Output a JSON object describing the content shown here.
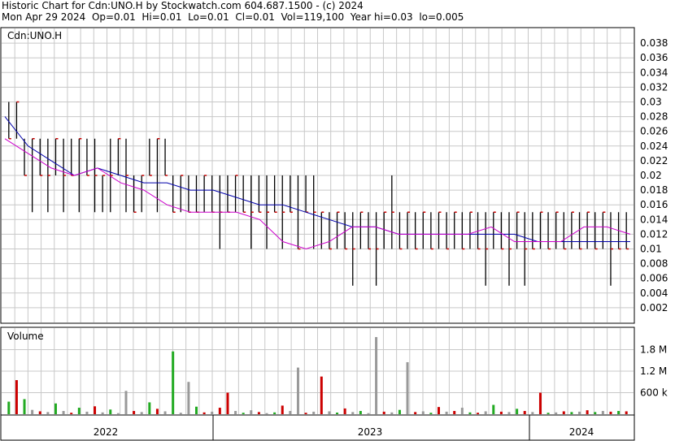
{
  "header": {
    "line1": "Historic Chart for Cdn:UNO.H by Stockwatch.com 604.687.1500 - (c) 2024",
    "line2": "Mon Apr 29 2024  Op=0.01  Hi=0.01  Lo=0.01  Cl=0.01  Vol=119,100  Year hi=0.03  lo=0.005"
  },
  "colors": {
    "grid": "#c8c8c8",
    "price_bar": "#000000",
    "close_mark": "#cc0000",
    "ma_short": "#cc00cc",
    "ma_long": "#0000aa",
    "vol_up": "#22aa22",
    "vol_down": "#cc0000",
    "vol_flat": "#999999"
  },
  "chart_data": [
    {
      "type": "line",
      "title": "Cdn:UNO.H",
      "ylim": [
        0,
        0.04
      ],
      "y_ticks": [
        "0.038",
        "0.036",
        "0.034",
        "0.032",
        "0.03",
        "0.028",
        "0.026",
        "0.024",
        "0.022",
        "0.02",
        "0.018",
        "0.016",
        "0.014",
        "0.012",
        "0.01",
        "0.008",
        "0.006",
        "0.004",
        "0.002"
      ],
      "x_labels": [
        "2022",
        "2023",
        "2024"
      ],
      "series": [
        {
          "x": [
            "2022-01",
            "2022-02",
            "2022-03",
            "2022-04",
            "2022-05",
            "2022-06",
            "2022-07",
            "2022-08",
            "2022-09",
            "2022-10",
            "2022-11",
            "2022-12",
            "2023-01",
            "2023-02",
            "2023-03",
            "2023-04",
            "2023-05",
            "2023-06",
            "2023-07",
            "2023-08",
            "2023-09",
            "2023-10",
            "2023-11",
            "2023-12",
            "2024-01",
            "2024-02",
            "2024-03",
            "2024-04"
          ],
          "values": [
            0.028,
            0.024,
            0.022,
            0.02,
            0.021,
            0.02,
            0.019,
            0.019,
            0.018,
            0.018,
            0.017,
            0.016,
            0.016,
            0.015,
            0.014,
            0.013,
            0.013,
            0.012,
            0.012,
            0.012,
            0.012,
            0.012,
            0.012,
            0.011,
            0.011,
            0.011,
            0.011,
            0.011
          ]
        },
        {
          "x": [
            "2022-01",
            "2022-02",
            "2022-03",
            "2022-04",
            "2022-05",
            "2022-06",
            "2022-07",
            "2022-08",
            "2022-09",
            "2022-10",
            "2022-11",
            "2022-12",
            "2023-01",
            "2023-02",
            "2023-03",
            "2023-04",
            "2023-05",
            "2023-06",
            "2023-07",
            "2023-08",
            "2023-09",
            "2023-10",
            "2023-11",
            "2023-12",
            "2024-01",
            "2024-02",
            "2024-03",
            "2024-04"
          ],
          "values": [
            0.025,
            0.023,
            0.021,
            0.02,
            0.021,
            0.019,
            0.018,
            0.016,
            0.015,
            0.015,
            0.015,
            0.014,
            0.011,
            0.01,
            0.011,
            0.013,
            0.013,
            0.012,
            0.012,
            0.012,
            0.012,
            0.013,
            0.011,
            0.011,
            0.011,
            0.013,
            0.013,
            0.012
          ]
        }
      ],
      "price_bars": [
        [
          0.03,
          0.025,
          0.025
        ],
        [
          0.03,
          0.025,
          0.03
        ],
        [
          0.025,
          0.02,
          0.02
        ],
        [
          0.025,
          0.015,
          0.025
        ],
        [
          0.025,
          0.02,
          0.02
        ],
        [
          0.025,
          0.015,
          0.02
        ],
        [
          0.025,
          0.02,
          0.025
        ],
        [
          0.025,
          0.015,
          0.02
        ],
        [
          0.025,
          0.02,
          0.02
        ],
        [
          0.025,
          0.015,
          0.025
        ],
        [
          0.025,
          0.02,
          0.02
        ],
        [
          0.025,
          0.015,
          0.02
        ],
        [
          0.02,
          0.015,
          0.02
        ],
        [
          0.025,
          0.015,
          0.02
        ],
        [
          0.025,
          0.02,
          0.025
        ],
        [
          0.025,
          0.015,
          0.02
        ],
        [
          0.02,
          0.015,
          0.015
        ],
        [
          0.02,
          0.015,
          0.02
        ],
        [
          0.025,
          0.02,
          0.02
        ],
        [
          0.025,
          0.015,
          0.025
        ],
        [
          0.025,
          0.02,
          0.02
        ],
        [
          0.02,
          0.015,
          0.015
        ],
        [
          0.02,
          0.015,
          0.02
        ],
        [
          0.02,
          0.015,
          0.015
        ],
        [
          0.02,
          0.015,
          0.015
        ],
        [
          0.02,
          0.015,
          0.02
        ],
        [
          0.02,
          0.015,
          0.015
        ],
        [
          0.02,
          0.01,
          0.015
        ],
        [
          0.02,
          0.015,
          0.015
        ],
        [
          0.02,
          0.015,
          0.02
        ],
        [
          0.02,
          0.015,
          0.015
        ],
        [
          0.02,
          0.01,
          0.015
        ],
        [
          0.02,
          0.015,
          0.015
        ],
        [
          0.02,
          0.01,
          0.015
        ],
        [
          0.02,
          0.015,
          0.015
        ],
        [
          0.02,
          0.01,
          0.015
        ],
        [
          0.02,
          0.015,
          0.015
        ],
        [
          0.02,
          0.01,
          0.01
        ],
        [
          0.02,
          0.015,
          0.015
        ],
        [
          0.02,
          0.01,
          0.015
        ],
        [
          0.015,
          0.01,
          0.015
        ],
        [
          0.015,
          0.01,
          0.01
        ],
        [
          0.015,
          0.01,
          0.015
        ],
        [
          0.015,
          0.01,
          0.01
        ],
        [
          0.015,
          0.005,
          0.01
        ],
        [
          0.015,
          0.01,
          0.015
        ],
        [
          0.015,
          0.01,
          0.01
        ],
        [
          0.015,
          0.005,
          0.01
        ],
        [
          0.015,
          0.01,
          0.015
        ],
        [
          0.02,
          0.01,
          0.015
        ],
        [
          0.015,
          0.01,
          0.01
        ],
        [
          0.015,
          0.01,
          0.015
        ],
        [
          0.015,
          0.01,
          0.01
        ],
        [
          0.015,
          0.01,
          0.015
        ],
        [
          0.015,
          0.01,
          0.01
        ],
        [
          0.015,
          0.01,
          0.015
        ],
        [
          0.015,
          0.01,
          0.01
        ],
        [
          0.015,
          0.01,
          0.015
        ],
        [
          0.015,
          0.01,
          0.01
        ],
        [
          0.015,
          0.01,
          0.015
        ],
        [
          0.015,
          0.01,
          0.01
        ],
        [
          0.015,
          0.005,
          0.01
        ],
        [
          0.015,
          0.01,
          0.015
        ],
        [
          0.015,
          0.01,
          0.01
        ],
        [
          0.015,
          0.005,
          0.01
        ],
        [
          0.015,
          0.01,
          0.015
        ],
        [
          0.015,
          0.005,
          0.01
        ],
        [
          0.015,
          0.01,
          0.01
        ],
        [
          0.015,
          0.01,
          0.015
        ],
        [
          0.015,
          0.01,
          0.01
        ],
        [
          0.015,
          0.01,
          0.015
        ],
        [
          0.015,
          0.01,
          0.01
        ],
        [
          0.015,
          0.01,
          0.015
        ],
        [
          0.015,
          0.01,
          0.01
        ],
        [
          0.015,
          0.01,
          0.015
        ],
        [
          0.015,
          0.01,
          0.01
        ],
        [
          0.015,
          0.01,
          0.015
        ],
        [
          0.015,
          0.005,
          0.01
        ],
        [
          0.015,
          0.01,
          0.01
        ],
        [
          0.015,
          0.01,
          0.01
        ]
      ],
      "grid": true,
      "legend": "none"
    },
    {
      "type": "bar",
      "title": "Volume",
      "ylim": [
        0,
        2400000
      ],
      "y_ticks": [
        "1.8 M",
        "1.2 M",
        "600 k"
      ],
      "values": [
        350000,
        950000,
        420000,
        120000,
        80000,
        60000,
        300000,
        90000,
        40000,
        180000,
        70000,
        220000,
        50000,
        130000,
        30000,
        650000,
        90000,
        60000,
        330000,
        150000,
        80000,
        1750000,
        40000,
        900000,
        210000,
        50000,
        70000,
        180000,
        600000,
        90000,
        40000,
        110000,
        60000,
        30000,
        50000,
        240000,
        90000,
        1300000,
        40000,
        70000,
        1050000,
        80000,
        45000,
        160000,
        60000,
        90000,
        30000,
        2150000,
        70000,
        50000,
        120000,
        1450000,
        60000,
        80000,
        40000,
        200000,
        70000,
        90000,
        180000,
        50000,
        40000,
        80000,
        260000,
        70000,
        60000,
        150000,
        90000,
        60000,
        600000,
        40000,
        50000,
        80000,
        60000,
        70000,
        110000,
        60000,
        90000,
        70000,
        90000,
        80000
      ],
      "directions": [
        "up",
        "down",
        "up",
        "flat",
        "down",
        "flat",
        "up",
        "flat",
        "down",
        "up",
        "flat",
        "down",
        "flat",
        "up",
        "flat",
        "flat",
        "down",
        "flat",
        "up",
        "down",
        "flat",
        "up",
        "flat",
        "flat",
        "up",
        "down",
        "flat",
        "down",
        "down",
        "flat",
        "up",
        "flat",
        "down",
        "flat",
        "up",
        "down",
        "flat",
        "flat",
        "down",
        "flat",
        "down",
        "flat",
        "up",
        "down",
        "flat",
        "up",
        "flat",
        "flat",
        "down",
        "flat",
        "up",
        "flat",
        "down",
        "flat",
        "up",
        "down",
        "flat",
        "down",
        "flat",
        "up",
        "down",
        "flat",
        "up",
        "down",
        "flat",
        "up",
        "down",
        "flat",
        "down",
        "up",
        "flat",
        "down",
        "up",
        "flat",
        "down",
        "up",
        "flat",
        "down",
        "up",
        "down"
      ]
    }
  ]
}
